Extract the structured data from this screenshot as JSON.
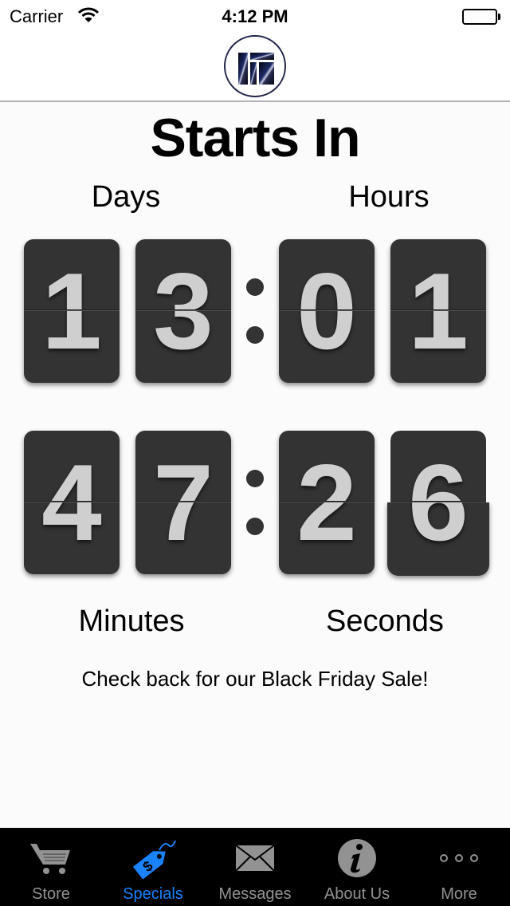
{
  "status_bar": {
    "carrier": "Carrier",
    "time": "4:12 PM",
    "battery_level": 1.0
  },
  "nav": {
    "logo": "company-logo"
  },
  "countdown": {
    "title": "Starts In",
    "labels": {
      "days": "Days",
      "hours": "Hours",
      "minutes": "Minutes",
      "seconds": "Seconds"
    },
    "days": [
      "1",
      "3"
    ],
    "hours": [
      "0",
      "1"
    ],
    "minutes": [
      "4",
      "7"
    ],
    "seconds": [
      "2",
      "6"
    ],
    "separator": ":"
  },
  "message": "Check back for our Black Friday Sale!",
  "colors": {
    "card": "#333333",
    "digit": "#cfcfcf",
    "tab_active": "#1a82fb",
    "tab_inactive": "#929292"
  },
  "tabs": [
    {
      "label": "Store",
      "icon": "shopping-cart-icon",
      "active": false
    },
    {
      "label": "Specials",
      "icon": "price-tag-icon",
      "active": true
    },
    {
      "label": "Messages",
      "icon": "envelope-icon",
      "active": false
    },
    {
      "label": "About Us",
      "icon": "info-icon",
      "active": false
    },
    {
      "label": "More",
      "icon": "more-dots-icon",
      "active": false
    }
  ]
}
